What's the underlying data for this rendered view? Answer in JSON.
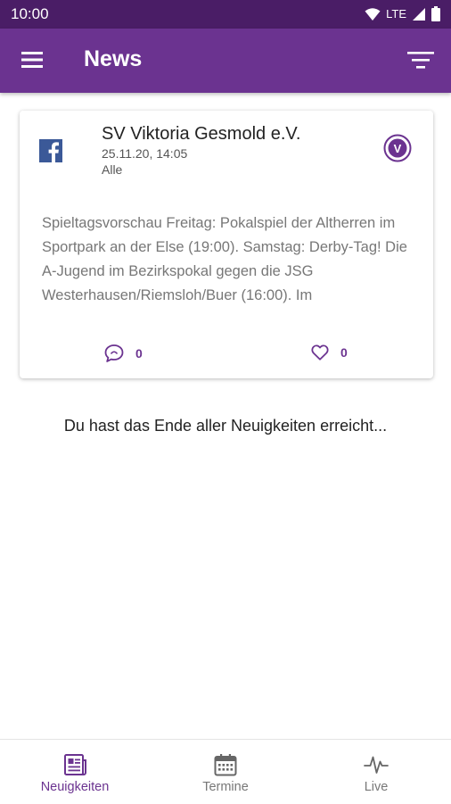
{
  "status_bar": {
    "time": "10:00",
    "network": "LTE",
    "icons": [
      "wifi-icon",
      "signal-icon",
      "battery-icon"
    ]
  },
  "app_bar": {
    "title": "News",
    "menu_icon": "hamburger-menu-icon",
    "filter_icon": "filter-icon"
  },
  "colors": {
    "primary": "#6b3390",
    "status_bar": "#4a1d66",
    "facebook": "#3b5998",
    "muted_text": "#777777"
  },
  "post": {
    "source_icon": "facebook-icon",
    "club_name": "SV Viktoria Gesmold e.V.",
    "date": "25.11.20, 14:05",
    "audience": "Alle",
    "club_logo_letter": "V",
    "text": "Spieltagsvorschau Freitag: Pokalspiel der Altherren im Sportpark an der Else (19:00). Samstag: Derby-Tag! Die A-Jugend im Bezirkspokal gegen die JSG Westerhausen/Riemsloh/Buer (16:00). Im",
    "comments": "0",
    "likes": "0"
  },
  "end_message": "Du hast das Ende aller Neuigkeiten erreicht...",
  "bottom_nav": [
    {
      "label": "Neuigkeiten",
      "icon": "newspaper-icon",
      "active": true
    },
    {
      "label": "Termine",
      "icon": "calendar-icon",
      "active": false
    },
    {
      "label": "Live",
      "icon": "pulse-icon",
      "active": false
    }
  ]
}
